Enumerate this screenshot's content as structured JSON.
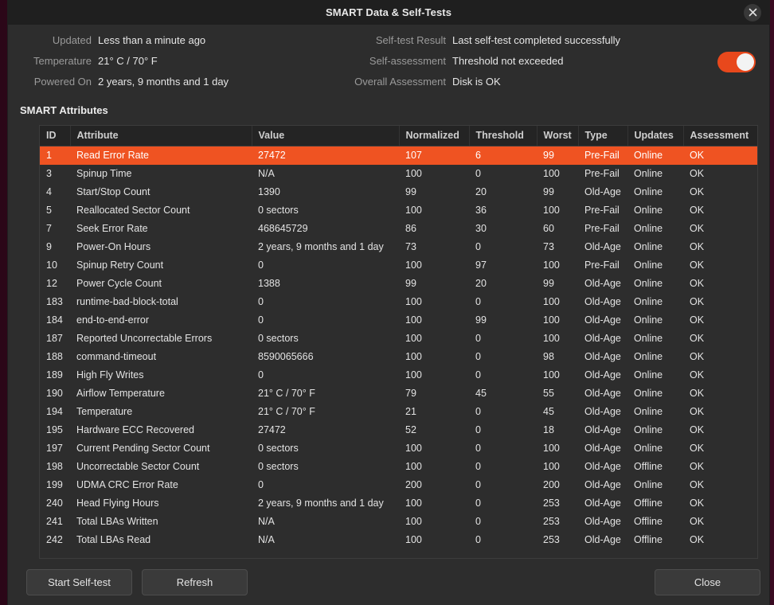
{
  "window": {
    "title": "SMART Data & Self-Tests",
    "close_icon": "close-icon"
  },
  "info": {
    "left": [
      {
        "label": "Updated",
        "value": "Less than a minute ago"
      },
      {
        "label": "Temperature",
        "value": "21° C / 70° F"
      },
      {
        "label": "Powered On",
        "value": "2 years, 9 months and 1 day"
      }
    ],
    "right": [
      {
        "label": "Self-test Result",
        "value": "Last self-test completed successfully"
      },
      {
        "label": "Self-assessment",
        "value": "Threshold not exceeded"
      },
      {
        "label": "Overall Assessment",
        "value": "Disk is OK"
      }
    ],
    "toggle": {
      "name": "smart-enabled-toggle",
      "state": "on",
      "color": "#e8481c"
    }
  },
  "attributes_heading": "SMART Attributes",
  "table": {
    "columns": [
      "ID",
      "Attribute",
      "Value",
      "Normalized",
      "Threshold",
      "Worst",
      "Type",
      "Updates",
      "Assessment"
    ],
    "selected_row_index": 0,
    "selected_color": "#ef5322",
    "rows": [
      {
        "id": "1",
        "attribute": "Read Error Rate",
        "value": "27472",
        "normalized": "107",
        "threshold": "6",
        "worst": "99",
        "type": "Pre-Fail",
        "updates": "Online",
        "assessment": "OK"
      },
      {
        "id": "3",
        "attribute": "Spinup Time",
        "value": "N/A",
        "normalized": "100",
        "threshold": "0",
        "worst": "100",
        "type": "Pre-Fail",
        "updates": "Online",
        "assessment": "OK"
      },
      {
        "id": "4",
        "attribute": "Start/Stop Count",
        "value": "1390",
        "normalized": "99",
        "threshold": "20",
        "worst": "99",
        "type": "Old-Age",
        "updates": "Online",
        "assessment": "OK"
      },
      {
        "id": "5",
        "attribute": "Reallocated Sector Count",
        "value": "0 sectors",
        "normalized": "100",
        "threshold": "36",
        "worst": "100",
        "type": "Pre-Fail",
        "updates": "Online",
        "assessment": "OK"
      },
      {
        "id": "7",
        "attribute": "Seek Error Rate",
        "value": "468645729",
        "normalized": "86",
        "threshold": "30",
        "worst": "60",
        "type": "Pre-Fail",
        "updates": "Online",
        "assessment": "OK"
      },
      {
        "id": "9",
        "attribute": "Power-On Hours",
        "value": "2 years, 9 months and 1 day",
        "normalized": "73",
        "threshold": "0",
        "worst": "73",
        "type": "Old-Age",
        "updates": "Online",
        "assessment": "OK"
      },
      {
        "id": "10",
        "attribute": "Spinup Retry Count",
        "value": "0",
        "normalized": "100",
        "threshold": "97",
        "worst": "100",
        "type": "Pre-Fail",
        "updates": "Online",
        "assessment": "OK"
      },
      {
        "id": "12",
        "attribute": "Power Cycle Count",
        "value": "1388",
        "normalized": "99",
        "threshold": "20",
        "worst": "99",
        "type": "Old-Age",
        "updates": "Online",
        "assessment": "OK"
      },
      {
        "id": "183",
        "attribute": "runtime-bad-block-total",
        "value": "0",
        "normalized": "100",
        "threshold": "0",
        "worst": "100",
        "type": "Old-Age",
        "updates": "Online",
        "assessment": "OK"
      },
      {
        "id": "184",
        "attribute": "end-to-end-error",
        "value": "0",
        "normalized": "100",
        "threshold": "99",
        "worst": "100",
        "type": "Old-Age",
        "updates": "Online",
        "assessment": "OK"
      },
      {
        "id": "187",
        "attribute": "Reported Uncorrectable Errors",
        "value": "0 sectors",
        "normalized": "100",
        "threshold": "0",
        "worst": "100",
        "type": "Old-Age",
        "updates": "Online",
        "assessment": "OK"
      },
      {
        "id": "188",
        "attribute": "command-timeout",
        "value": "8590065666",
        "normalized": "100",
        "threshold": "0",
        "worst": "98",
        "type": "Old-Age",
        "updates": "Online",
        "assessment": "OK"
      },
      {
        "id": "189",
        "attribute": "High Fly Writes",
        "value": "0",
        "normalized": "100",
        "threshold": "0",
        "worst": "100",
        "type": "Old-Age",
        "updates": "Online",
        "assessment": "OK"
      },
      {
        "id": "190",
        "attribute": "Airflow Temperature",
        "value": "21° C / 70° F",
        "normalized": "79",
        "threshold": "45",
        "worst": "55",
        "type": "Old-Age",
        "updates": "Online",
        "assessment": "OK"
      },
      {
        "id": "194",
        "attribute": "Temperature",
        "value": "21° C / 70° F",
        "normalized": "21",
        "threshold": "0",
        "worst": "45",
        "type": "Old-Age",
        "updates": "Online",
        "assessment": "OK"
      },
      {
        "id": "195",
        "attribute": "Hardware ECC Recovered",
        "value": "27472",
        "normalized": "52",
        "threshold": "0",
        "worst": "18",
        "type": "Old-Age",
        "updates": "Online",
        "assessment": "OK"
      },
      {
        "id": "197",
        "attribute": "Current Pending Sector Count",
        "value": "0 sectors",
        "normalized": "100",
        "threshold": "0",
        "worst": "100",
        "type": "Old-Age",
        "updates": "Online",
        "assessment": "OK"
      },
      {
        "id": "198",
        "attribute": "Uncorrectable Sector Count",
        "value": "0 sectors",
        "normalized": "100",
        "threshold": "0",
        "worst": "100",
        "type": "Old-Age",
        "updates": "Offline",
        "assessment": "OK"
      },
      {
        "id": "199",
        "attribute": "UDMA CRC Error Rate",
        "value": "0",
        "normalized": "200",
        "threshold": "0",
        "worst": "200",
        "type": "Old-Age",
        "updates": "Online",
        "assessment": "OK"
      },
      {
        "id": "240",
        "attribute": "Head Flying Hours",
        "value": "2 years, 9 months and 1 day",
        "normalized": "100",
        "threshold": "0",
        "worst": "253",
        "type": "Old-Age",
        "updates": "Offline",
        "assessment": "OK"
      },
      {
        "id": "241",
        "attribute": "Total LBAs Written",
        "value": "N/A",
        "normalized": "100",
        "threshold": "0",
        "worst": "253",
        "type": "Old-Age",
        "updates": "Offline",
        "assessment": "OK"
      },
      {
        "id": "242",
        "attribute": "Total LBAs Read",
        "value": "N/A",
        "normalized": "100",
        "threshold": "0",
        "worst": "253",
        "type": "Old-Age",
        "updates": "Offline",
        "assessment": "OK"
      }
    ]
  },
  "footer": {
    "start_self_test": "Start Self-test",
    "refresh": "Refresh",
    "close": "Close"
  }
}
